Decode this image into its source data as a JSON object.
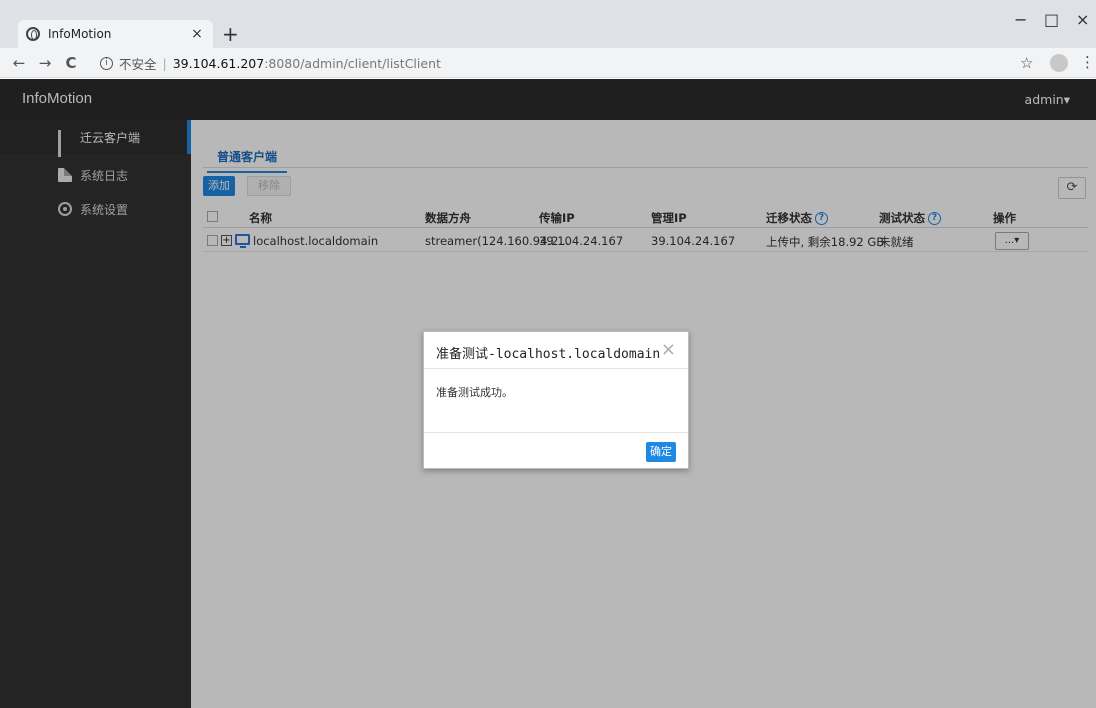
{
  "browser": {
    "tab_title": "InfoMotion",
    "tab_close": "×",
    "new_tab": "+",
    "url_not_secure": "不安全",
    "url_separator": "|",
    "url_host": "39.104.61.207",
    "url_path": ":8080/admin/client/listClient",
    "back": "←",
    "forward": "→",
    "reload": "C",
    "star": "☆",
    "menu": "⋮",
    "minimize": "−",
    "maximize": "□",
    "close": "×"
  },
  "header": {
    "brand": "InfoMotion",
    "user": "admin▾"
  },
  "sidebar": {
    "items": [
      {
        "label": "迁云客户端",
        "icon": "bar-chart-icon",
        "active": true
      },
      {
        "label": "系统日志",
        "icon": "document-icon",
        "active": false
      },
      {
        "label": "系统设置",
        "icon": "settings-icon",
        "active": false
      }
    ]
  },
  "main": {
    "tab_label": "普通客户端",
    "add_label": "添加",
    "remove_label": "移除",
    "refresh_icon": "⟳",
    "columns": {
      "name": "名称",
      "data_ferry": "数据方舟",
      "transfer_ip": "传输IP",
      "mgmt_ip": "管理IP",
      "migrate_status": "迁移状态",
      "test_status": "测试状态",
      "ops": "操作"
    },
    "rows": [
      {
        "name": "localhost.localdomain",
        "data_ferry": "streamer(124.160.94.2...",
        "transfer_ip": "39.104.24.167",
        "mgmt_ip": "39.104.24.167",
        "migrate_status": "上传中, 剩余18.92 GB",
        "test_status": "未就绪",
        "ops_label": "...▾"
      }
    ]
  },
  "modal": {
    "title": "准备测试-localhost.localdomain",
    "close": "×",
    "message": "准备测试成功。",
    "ok_label": "确定"
  }
}
